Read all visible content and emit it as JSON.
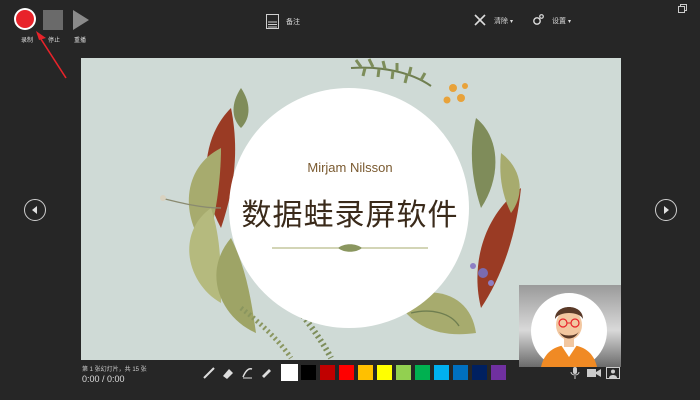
{
  "toolbar": {
    "record_label": "录制",
    "stop_label": "停止",
    "replay_label": "重播",
    "notes_label": "备注",
    "clear_label": "清除",
    "settings_label": "设置",
    "caret": "▾"
  },
  "slide": {
    "author": "Mirjam Nilsson",
    "title": "数据蛙录屏软件"
  },
  "status": {
    "slide_info": "第 1 张幻灯片，共 15 张",
    "timer": "0:00 / 0:00"
  },
  "pen_colors": [
    "#ffffff",
    "#000000",
    "#c00000",
    "#ff0000",
    "#ffc000",
    "#ffff00",
    "#92d050",
    "#00b050",
    "#00b0f0",
    "#0070c0",
    "#002060",
    "#7030a0"
  ],
  "colors": {
    "record": "#e8232a",
    "annotation_arrow": "#e8232a",
    "slide_bg": "#cfdad6"
  },
  "icons": [
    "record-icon",
    "stop-icon",
    "replay-icon",
    "notes-icon",
    "clear-icon",
    "settings-icon",
    "prev-slide-icon",
    "next-slide-icon",
    "pen-icon",
    "eraser-icon",
    "laser-pointer-icon",
    "highlighter-icon",
    "microphone-icon",
    "camera-icon",
    "person-icon",
    "restore-icon"
  ]
}
